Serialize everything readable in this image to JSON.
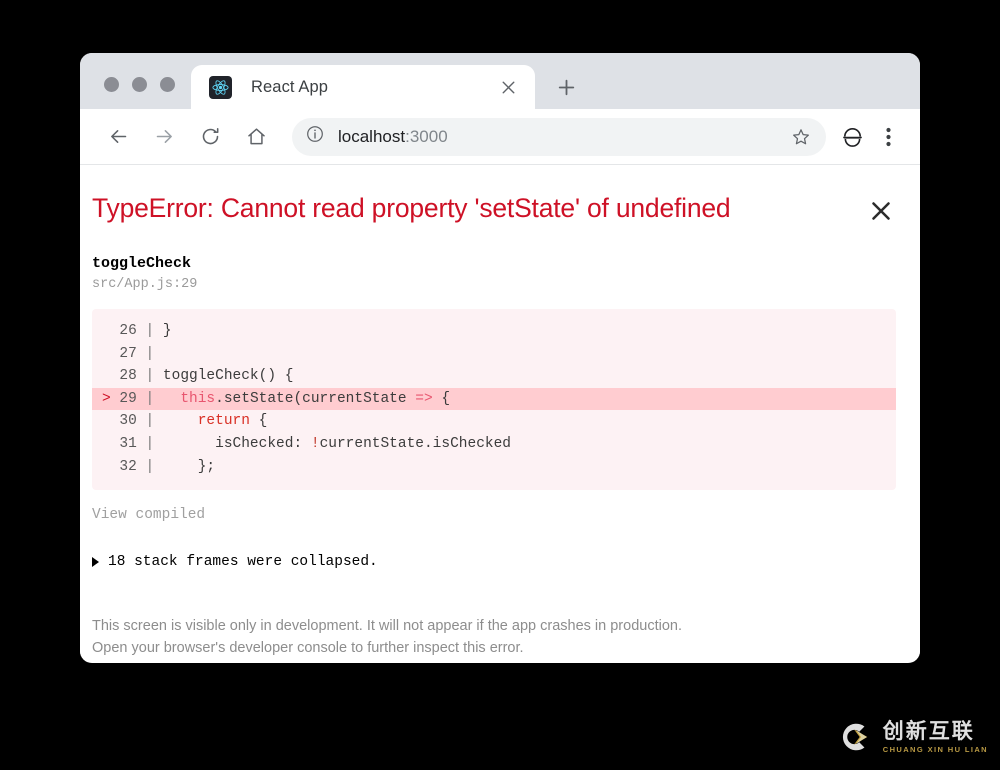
{
  "browser": {
    "tab": {
      "title": "React App",
      "favicon_name": "react-logo-icon",
      "close_label": "✕"
    },
    "new_tab_label": "+",
    "toolbar": {
      "back_label": "←",
      "forward_label": "→",
      "reload_label": "↻",
      "home_label": "⌂",
      "site_info_label": "ⓘ",
      "url_host": "localhost",
      "url_port": ":3000",
      "url_full": "localhost:3000",
      "bookmark_label": "☆",
      "profile_label": "profile",
      "menu_label": "⋮"
    }
  },
  "error_overlay": {
    "title": "TypeError: Cannot read property 'setState' of undefined",
    "close_label": "✕",
    "frame_function": "toggleCheck",
    "frame_location": "src/App.js:29",
    "code": {
      "lines": [
        {
          "marker": "",
          "number": "26",
          "pipe": "|",
          "text": " }",
          "highlight": false
        },
        {
          "marker": "",
          "number": "27",
          "pipe": "|",
          "text": "",
          "highlight": false
        },
        {
          "marker": "",
          "number": "28",
          "pipe": "|",
          "text": " toggleCheck() {",
          "highlight": false
        },
        {
          "marker": ">",
          "number": "29",
          "pipe": "|",
          "text": "   this.setState(currentState => {",
          "highlight": true
        },
        {
          "marker": "",
          "number": "30",
          "pipe": "|",
          "text": "     return {",
          "highlight": false
        },
        {
          "marker": "",
          "number": "31",
          "pipe": "|",
          "text": "       isChecked: !currentState.isChecked",
          "highlight": false
        },
        {
          "marker": "",
          "number": "32",
          "pipe": "|",
          "text": "     };",
          "highlight": false
        }
      ]
    },
    "view_compiled_label": "View compiled",
    "collapsed_frames_label": "18 stack frames were collapsed.",
    "footer_line_1": "This screen is visible only in development. It will not appear if the app crashes in production.",
    "footer_line_2": "Open your browser's developer console to further inspect this error.",
    "colors": {
      "title": "#ce1126",
      "code_background": "#fdf2f4",
      "code_highlight": "#ffccd0"
    }
  },
  "watermark": {
    "logo_name": "cx-logo-icon",
    "chinese": "创新互联",
    "pinyin": "CHUANG XIN HU LIAN"
  }
}
